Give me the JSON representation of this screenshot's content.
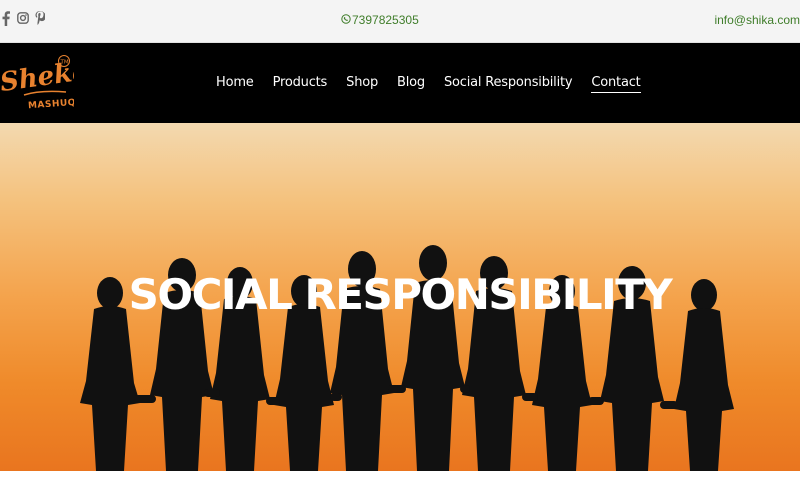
{
  "topbar": {
    "phone": "7397825305",
    "email": "info@shika.com",
    "social_icons": [
      "facebook-icon",
      "instagram-icon",
      "pinterest-icon"
    ]
  },
  "brand": {
    "logo_main": "Sheka",
    "logo_sub": "MASHUQ",
    "logo_mark": "TM",
    "accent_color": "#e8822f"
  },
  "nav": {
    "items": [
      {
        "label": "Home"
      },
      {
        "label": "Products"
      },
      {
        "label": "Shop"
      },
      {
        "label": "Blog"
      },
      {
        "label": "Social Responsibility"
      },
      {
        "label": "Contact"
      }
    ]
  },
  "hero": {
    "title": "SOCIAL RESPONSIBILITY"
  }
}
